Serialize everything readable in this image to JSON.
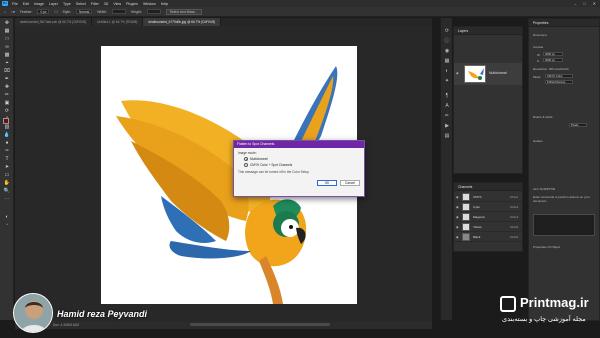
{
  "menubar": {
    "items": [
      "File",
      "Edit",
      "Image",
      "Layer",
      "Type",
      "Select",
      "Filter",
      "3D",
      "View",
      "Plugins",
      "Window",
      "Help"
    ]
  },
  "options": {
    "feather_label": "Feather:",
    "feather_value": "0 px",
    "style_label": "Style:",
    "style_value": "Normal",
    "width_label": "Width:",
    "height_label": "Height:",
    "select_mask": "Select and Mask..."
  },
  "tabs": [
    "dealbounded_Bb7dad.psb @ 66.7% (CMYK/8)",
    "Untitled-1 @ 66.7% (RGB/8)",
    "dealbounded_b779d0b.jpg @ 66.7% (CMYK/8)"
  ],
  "status": {
    "text": "Doc: 4.32M/8.61M"
  },
  "dialog": {
    "title": "Flatten to Spot Channels",
    "section_label": "Image mode:",
    "option1": "Multichannel",
    "option2": "CMYK Color + Spot Channels",
    "message": "This message can be turned off in the Color Setup",
    "ok_label": "OK",
    "cancel_label": "Cancel"
  },
  "layers": {
    "title": "Layers",
    "layer_name": "Multichannel"
  },
  "channels": {
    "title": "Channels",
    "rows": [
      {
        "name": "CMYK",
        "key": "Ctrl+2"
      },
      {
        "name": "Cyan",
        "key": "Ctrl+3"
      },
      {
        "name": "Magenta",
        "key": "Ctrl+4"
      },
      {
        "name": "Yellow",
        "key": "Ctrl+5"
      },
      {
        "name": "Black",
        "key": "Ctrl+6"
      }
    ]
  },
  "properties": {
    "title": "Properties",
    "document_label": "Document",
    "canvas_label": "Canvas",
    "w_label": "W",
    "h_label": "H",
    "w_value": "2000 px",
    "h_value": "2000 px",
    "resolution": "Resolution: 300 pixels/inch",
    "mode_label": "Mode",
    "mode_value": "CMYK Color",
    "depth_value": "8 Bits/Channel",
    "rulers_label": "Rulers & Grids",
    "rulers_unit": "Pixels",
    "guides_label": "Guides",
    "ai_title": "ALC SCRIPTOR",
    "ai_text": "Enter command to perform actions on your document.",
    "props_label": "Properties Of Object"
  },
  "overlay": {
    "presenter": "Hamid reza Peyvandi",
    "brand": "Printmag.ir",
    "brand_sub": "مجله آموزشی چاپ و بسته‌بندی"
  },
  "colors": {
    "accent": "#7027a6",
    "ps_blue": "#31a8ff"
  }
}
